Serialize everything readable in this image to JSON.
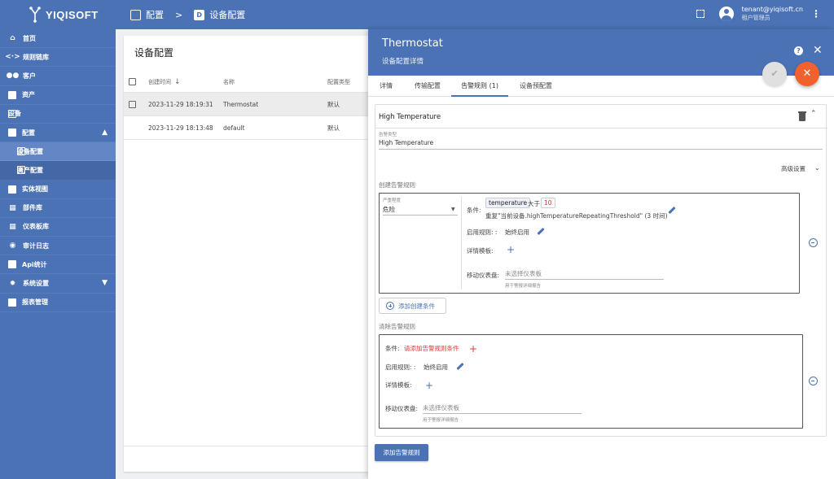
{
  "app": {
    "brand": "YIQISOFT"
  },
  "breadcrumb": {
    "parent": "配置",
    "current": "设备配置"
  },
  "user": {
    "email": "tenant@yiqisoft.cn",
    "role": "租户管理员"
  },
  "sidebar": {
    "items": [
      {
        "label": "首页",
        "icon": "home-icon"
      },
      {
        "label": "规则链库",
        "icon": "code-arrows-icon"
      },
      {
        "label": "客户",
        "icon": "people-icon"
      },
      {
        "label": "资产",
        "icon": "building-icon"
      },
      {
        "label": "设备",
        "icon": "device-icon"
      },
      {
        "label": "配置",
        "icon": "config-icon"
      },
      {
        "label": "设备配置",
        "icon": "device-profile-icon"
      },
      {
        "label": "资产配置",
        "icon": "asset-profile-icon"
      },
      {
        "label": "实体视图",
        "icon": "entity-view-icon"
      },
      {
        "label": "部件库",
        "icon": "widgets-icon"
      },
      {
        "label": "仪表板库",
        "icon": "dashboard-icon"
      },
      {
        "label": "审计日志",
        "icon": "audit-icon"
      },
      {
        "label": "Api统计",
        "icon": "api-stats-icon"
      },
      {
        "label": "系统设置",
        "icon": "gear-icon"
      },
      {
        "label": "报表管理",
        "icon": "report-icon"
      }
    ]
  },
  "list": {
    "title": "设备配置",
    "columns": {
      "created": "创建时间",
      "name": "名称",
      "type": "配置类型"
    },
    "rows": [
      {
        "created": "2023-11-29 18:19:31",
        "name": "Thermostat",
        "type": "默认"
      },
      {
        "created": "2023-11-29 18:13:48",
        "name": "default",
        "type": "默认"
      }
    ]
  },
  "panel": {
    "title": "Thermostat",
    "subtitle": "设备配置详情",
    "tabs": [
      "详情",
      "传输配置",
      "告警规则 (1)",
      "设备预配置"
    ],
    "rule": {
      "name": "High Temperature",
      "alarm_type_label": "告警类型",
      "alarm_type_value": "High Temperature",
      "advanced": "高级设置",
      "create_title": "创建告警规则",
      "severity_label": "严重程度",
      "severity_value": "危险",
      "condition_label": "条件:",
      "cond_key": "temperature",
      "cond_op": "大于",
      "cond_value": "10",
      "cond_repeat": "重复\"当前设备.highTemperatureRepeatingThreshold\" (3 时间)",
      "schedule_label": "启用规则: :",
      "schedule_value": "始终启用",
      "details_label": "详情模板:",
      "mobile_label": "移动仪表盘:",
      "mobile_placeholder": "未选择仪表板",
      "mobile_hint": "用于警报详细报告",
      "add_create_condition": "添加创建条件",
      "clear_title": "清除告警规则",
      "clear_condition_label": "条件:",
      "clear_condition_prompt": "请添加告警规则条件",
      "clear_schedule_label": "启用规则: :",
      "clear_schedule_value": "始终启用",
      "clear_details_label": "详情模板:",
      "clear_mobile_label": "移动仪表盘:",
      "clear_mobile_placeholder": "未选择仪表板",
      "clear_mobile_hint": "用于警报详细报告"
    },
    "add_rule_button": "添加告警规则"
  }
}
